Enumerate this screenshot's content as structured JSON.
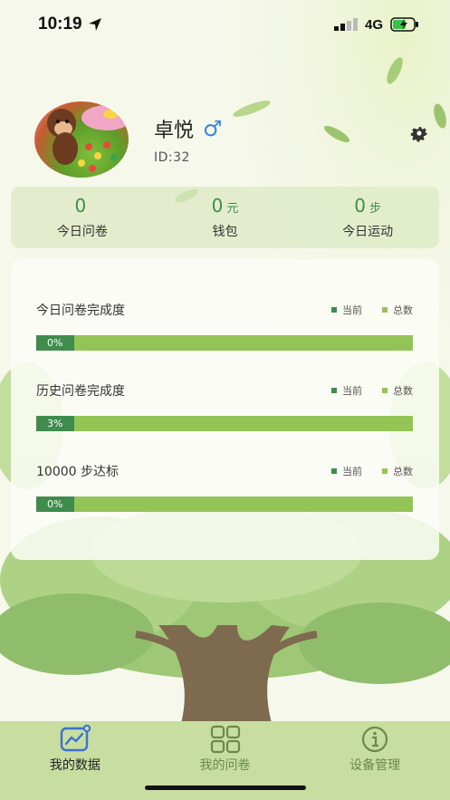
{
  "status_bar": {
    "time": "10:19",
    "network": "4G"
  },
  "profile": {
    "name": "卓悦",
    "gender_symbol": "♂",
    "id_text": "ID:32"
  },
  "stats": [
    {
      "value": "0",
      "unit": "",
      "label": "今日问卷"
    },
    {
      "value": "0",
      "unit": "元",
      "label": "钱包"
    },
    {
      "value": "0",
      "unit": "步",
      "label": "今日运动"
    }
  ],
  "progress": [
    {
      "title": "今日问卷完成度",
      "percent_text": "0%",
      "current_fraction": 0.0,
      "legend_current": "当前",
      "legend_total": "总数"
    },
    {
      "title": "历史问卷完成度",
      "percent_text": "3%",
      "current_fraction": 0.03,
      "legend_current": "当前",
      "legend_total": "总数"
    },
    {
      "title": "10000 步达标",
      "percent_text": "0%",
      "current_fraction": 0.0,
      "legend_current": "当前",
      "legend_total": "总数"
    }
  ],
  "tabs": [
    {
      "label": "我的数据",
      "icon": "chart-icon",
      "active": true
    },
    {
      "label": "我的问卷",
      "icon": "grid-icon",
      "active": false
    },
    {
      "label": "设备管理",
      "icon": "info-icon",
      "active": false
    }
  ],
  "colors": {
    "current": "#3f8c4c",
    "total": "#94c455",
    "accent_text": "#3d8f4a",
    "tabbar": "#c7dea0"
  }
}
